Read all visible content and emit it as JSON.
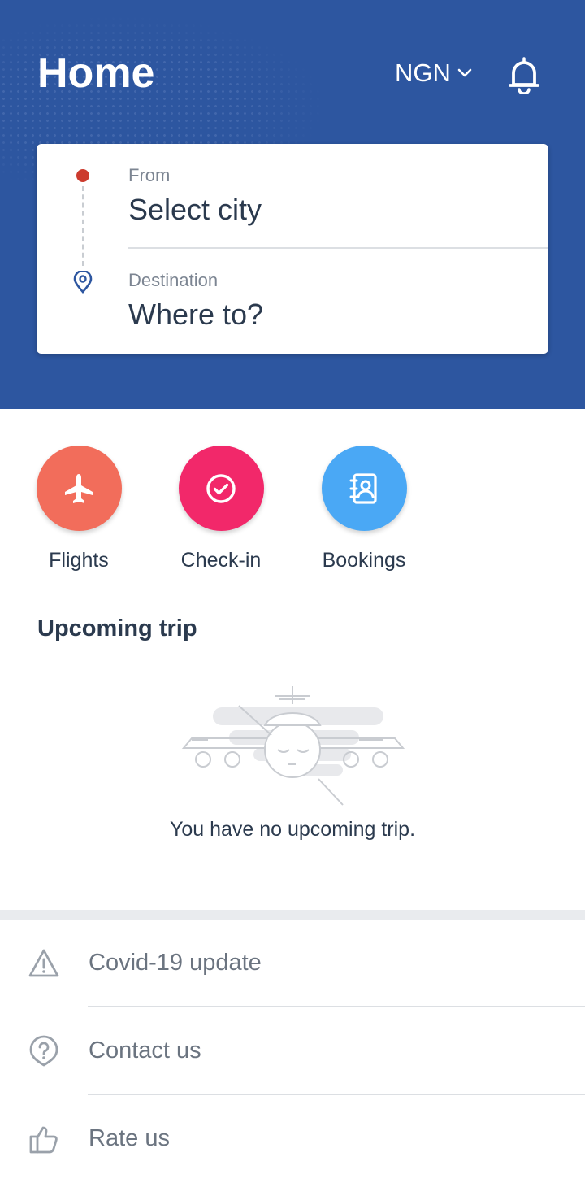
{
  "header": {
    "title": "Home",
    "currency": "NGN",
    "bg_color": "#2d56a0"
  },
  "search_card": {
    "from_label": "From",
    "from_value": "Select city",
    "destination_label": "Destination",
    "destination_value": "Where to?"
  },
  "quick_actions": [
    {
      "label": "Flights",
      "color": "#f26d5b",
      "icon": "airplane-icon"
    },
    {
      "label": "Check-in",
      "color": "#f2286a",
      "icon": "check-circle-icon"
    },
    {
      "label": "Bookings",
      "color": "#4aa8f5",
      "icon": "contact-book-icon"
    }
  ],
  "upcoming": {
    "heading": "Upcoming trip",
    "empty_message": "You have no upcoming trip."
  },
  "menu": [
    {
      "label": "Covid-19 update",
      "icon": "warning-triangle-icon"
    },
    {
      "label": "Contact us",
      "icon": "question-bubble-icon"
    },
    {
      "label": "Rate us",
      "icon": "thumbs-up-icon"
    }
  ]
}
